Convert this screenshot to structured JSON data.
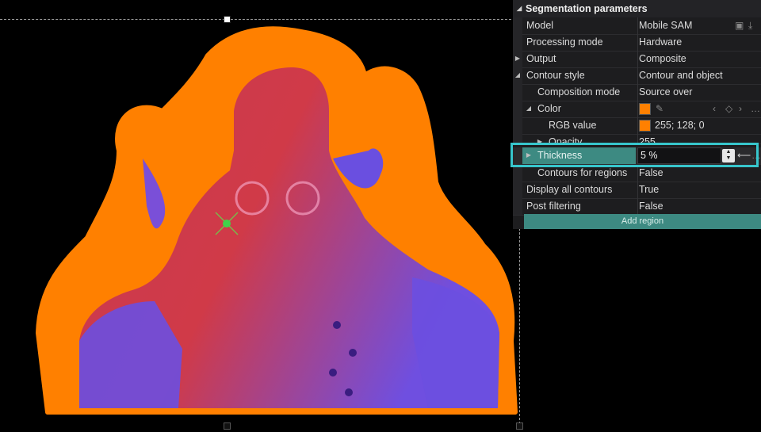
{
  "panel": {
    "title": "Segmentation parameters",
    "rows": [
      {
        "name": "Model",
        "value": "Mobile SAM"
      },
      {
        "name": "Processing mode",
        "value": "Hardware"
      },
      {
        "name": "Output",
        "value": "Composite"
      },
      {
        "name": "Contour style",
        "value": "Contour and object"
      },
      {
        "name": "Composition mode",
        "value": "Source over"
      },
      {
        "name": "Color",
        "value": ""
      },
      {
        "name": "RGB value",
        "value": "255; 128; 0"
      },
      {
        "name": "Opacity",
        "value": "255"
      },
      {
        "name": "Thickness",
        "value": "5 %"
      },
      {
        "name": "Contours for regions",
        "value": "False"
      },
      {
        "name": "Display all contours",
        "value": "True"
      },
      {
        "name": "Post filtering",
        "value": "False"
      }
    ],
    "add_region_label": "Add region"
  },
  "colors": {
    "contour": "#ff8000",
    "highlight": "#37c6cc",
    "accent": "#3d8a82",
    "object_red": "#d33a4a",
    "object_violet": "#6a4fe0"
  },
  "icons": [
    "folder-open-icon",
    "download-icon",
    "eyedropper-icon",
    "keyframe-prev-icon",
    "keyframe-add-icon",
    "keyframe-next-icon",
    "more-icon",
    "spinner-up-icon",
    "spinner-down-icon",
    "reset-arrow-icon",
    "anchor-point-icon"
  ]
}
